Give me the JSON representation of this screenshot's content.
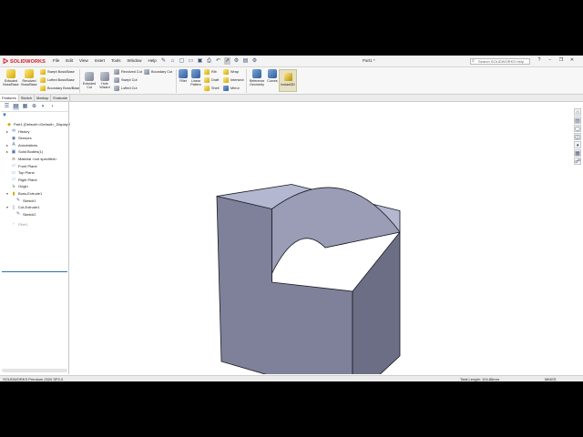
{
  "app": {
    "logo_text": "SOLIDWORKS",
    "document_title": "Part1 *",
    "menu": [
      "File",
      "Edit",
      "View",
      "Insert",
      "Tools",
      "Window",
      "Help"
    ],
    "search_placeholder": "Search SOLIDWORKS Help",
    "window_buttons": [
      "?",
      "−",
      "❐",
      "✕"
    ]
  },
  "ribbon": {
    "boss_base": {
      "extruded": "Extruded\nBoss/Base",
      "revolved": "Revolved\nBoss/Base",
      "swept": "Swept Boss/Base",
      "lofted": "Lofted Boss/Base",
      "boundary": "Boundary Boss/Base"
    },
    "cut": {
      "extruded": "Extruded\nCut",
      "hole_wizard": "Hole\nWizard",
      "revolved": "Revolved Cut",
      "swept": "Swept Cut",
      "lofted": "Lofted Cut",
      "boundary": "Boundary Cut"
    },
    "features": {
      "fillet": "Fillet",
      "linear_pattern": "Linear\nPattern",
      "rib": "Rib",
      "draft": "Draft",
      "shell": "Shell",
      "wrap": "Wrap",
      "intersect": "Intersect",
      "mirror": "Mirror",
      "reference_geometry": "Reference\nGeometry",
      "curves": "Curves",
      "instant3d": "Instant3D"
    }
  },
  "tabs": [
    "Features",
    "Sketch",
    "Markup",
    "Evaluate"
  ],
  "active_tab": "Features",
  "feature_tree": [
    {
      "label": "Part1 (Default<<Default>_Display Sta",
      "icon": "part-icon",
      "indent": 0,
      "expand": ""
    },
    {
      "label": "History",
      "icon": "history-icon",
      "indent": 1,
      "expand": "▸"
    },
    {
      "label": "Sensors",
      "icon": "sensors-icon",
      "indent": 1,
      "expand": ""
    },
    {
      "label": "Annotations",
      "icon": "annotations-icon",
      "indent": 1,
      "expand": "▸"
    },
    {
      "label": "Solid Bodies(1)",
      "icon": "solid-bodies-icon",
      "indent": 1,
      "expand": "▸"
    },
    {
      "label": "Material <not specified>",
      "icon": "material-icon",
      "indent": 1,
      "expand": ""
    },
    {
      "label": "Front Plane",
      "icon": "plane-icon",
      "indent": 1,
      "expand": ""
    },
    {
      "label": "Top Plane",
      "icon": "plane-icon",
      "indent": 1,
      "expand": ""
    },
    {
      "label": "Right Plane",
      "icon": "plane-icon",
      "indent": 1,
      "expand": ""
    },
    {
      "label": "Origin",
      "icon": "origin-icon",
      "indent": 1,
      "expand": ""
    },
    {
      "label": "Boss-Extrude1",
      "icon": "extrude-icon",
      "indent": 1,
      "expand": "▾"
    },
    {
      "label": "Sketch1",
      "icon": "sketch-icon",
      "indent": 2,
      "expand": ""
    },
    {
      "label": "Cut-Extrude1",
      "icon": "cut-extrude-icon",
      "indent": 1,
      "expand": "▾"
    },
    {
      "label": "Sketch2",
      "icon": "sketch-icon",
      "indent": 2,
      "expand": ""
    },
    {
      "label": "Fillet1",
      "icon": "fillet-icon",
      "indent": 1,
      "expand": "",
      "suppressed": true
    }
  ],
  "model_tab": "*Isometric",
  "statusbar": {
    "product": "SOLIDWORKS Premium 2020 SP2.0",
    "measure": "Total Length: 104.86mm",
    "units": "MMGS"
  },
  "colors": {
    "model_top": "#b3b7cf",
    "model_left": "#7e8199",
    "model_right": "#6b6e85",
    "model_edge": "#1b1b22",
    "brand_red": "#d71920",
    "accent_blue": "#2f6fb5"
  }
}
